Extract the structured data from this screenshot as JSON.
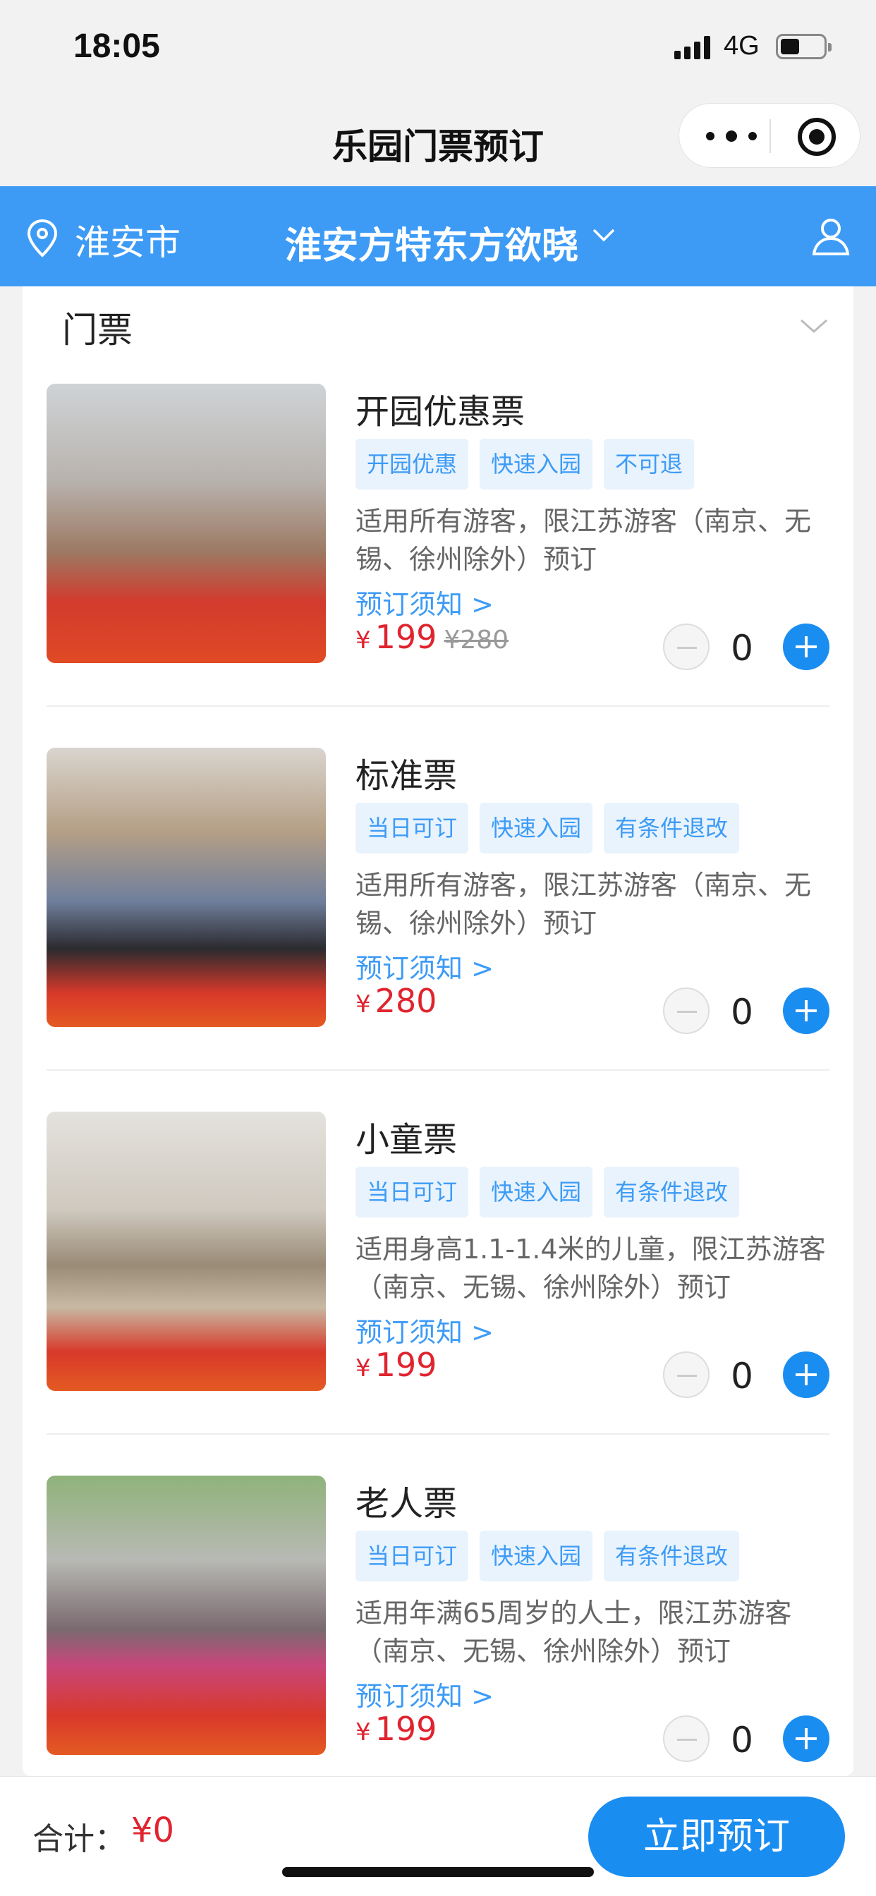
{
  "status": {
    "time": "18:05",
    "network": "4G"
  },
  "nav": {
    "title": "乐园门票预订"
  },
  "location_bar": {
    "city": "淮安市",
    "park": "淮安方特东方欲晓"
  },
  "section": {
    "title": "门票"
  },
  "tickets": [
    {
      "name": "开园优惠票",
      "tags": [
        "开园优惠",
        "快速入园",
        "不可退"
      ],
      "desc": "适用所有游客，限江苏游客（南京、无锡、徐州除外）预订",
      "notice": "预订须知 >",
      "currency": "¥",
      "price": "199",
      "original_price": "¥280",
      "qty": "0"
    },
    {
      "name": "标准票",
      "tags": [
        "当日可订",
        "快速入园",
        "有条件退改"
      ],
      "desc": "适用所有游客，限江苏游客（南京、无锡、徐州除外）预订",
      "notice": "预订须知 >",
      "currency": "¥",
      "price": "280",
      "original_price": "",
      "qty": "0"
    },
    {
      "name": "小童票",
      "tags": [
        "当日可订",
        "快速入园",
        "有条件退改"
      ],
      "desc": "适用身高1.1-1.4米的儿童，限江苏游客（南京、无锡、徐州除外）预订",
      "notice": "预订须知 >",
      "currency": "¥",
      "price": "199",
      "original_price": "",
      "qty": "0"
    },
    {
      "name": "老人票",
      "tags": [
        "当日可订",
        "快速入园",
        "有条件退改"
      ],
      "desc": "适用年满65周岁的人士，限江苏游客（南京、无锡、徐州除外）预订",
      "notice": "预订须知 >",
      "currency": "¥",
      "price": "199",
      "original_price": "",
      "qty": "0"
    }
  ],
  "footer": {
    "total_label": "合计：",
    "total_value": "¥0",
    "book_label": "立即预订"
  },
  "colors": {
    "brand_blue": "#3d9bf6",
    "button_blue": "#1a8df1",
    "price_red": "#e0242f"
  }
}
